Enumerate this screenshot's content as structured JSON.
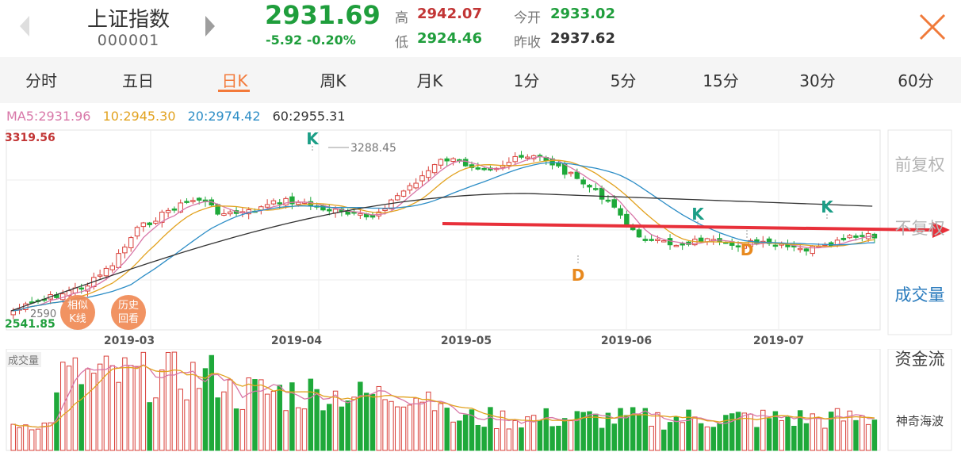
{
  "header": {
    "index_name": "上证指数",
    "index_code": "000001",
    "price": "2931.69",
    "change": "-5.92  -0.20%",
    "high_label": "高",
    "high_value": "2942.07",
    "low_label": "低",
    "low_value": "2924.46",
    "open_label": "今开",
    "open_value": "2933.02",
    "prev_close_label": "昨收",
    "prev_close_value": "2937.62",
    "nav_prev_icon": "chevron-left-icon",
    "nav_next_icon": "chevron-right-icon",
    "close_icon": "close-icon"
  },
  "tabs": [
    {
      "label": "分时",
      "active": false
    },
    {
      "label": "五日",
      "active": false
    },
    {
      "label": "日K",
      "active": true
    },
    {
      "label": "周K",
      "active": false
    },
    {
      "label": "月K",
      "active": false
    },
    {
      "label": "1分",
      "active": false
    },
    {
      "label": "5分",
      "active": false
    },
    {
      "label": "15分",
      "active": false
    },
    {
      "label": "30分",
      "active": false
    },
    {
      "label": "60分",
      "active": false
    }
  ],
  "ma_legend": {
    "ma5": "MA5:2931.96",
    "ma10": "10:2945.30",
    "ma20": "20:2974.42",
    "ma60": "60:2955.31"
  },
  "price_axis": {
    "high": "3319.56",
    "low": "2541.85",
    "peak_marker": "3288.45",
    "trough_marker": "2590"
  },
  "date_labels": [
    "2019-03",
    "2019-04",
    "2019-05",
    "2019-06",
    "2019-07"
  ],
  "signal_markers": [
    {
      "label": "K",
      "kind": "K"
    },
    {
      "label": "D",
      "kind": "D"
    },
    {
      "label": "K",
      "kind": "K"
    },
    {
      "label": "D",
      "kind": "D"
    },
    {
      "label": "K",
      "kind": "K"
    }
  ],
  "overlay_buttons": {
    "similar": [
      "相似",
      "K线"
    ],
    "history": [
      "历史",
      "回看"
    ]
  },
  "side_panel": {
    "front_adjust": "前复权",
    "no_adjust": "不复权",
    "volume": "成交量",
    "fund_flow": "资金流",
    "magic_wave": "神奇海波"
  },
  "volume_label": "成交量",
  "colors": {
    "up": "#d9403a",
    "down": "#1fa93a",
    "ma5": "#d877a8",
    "ma10": "#e2a21f",
    "ma20": "#2c8dc6",
    "ma60": "#333333",
    "accent": "#f37a3a",
    "arrow": "#e8303a"
  }
}
